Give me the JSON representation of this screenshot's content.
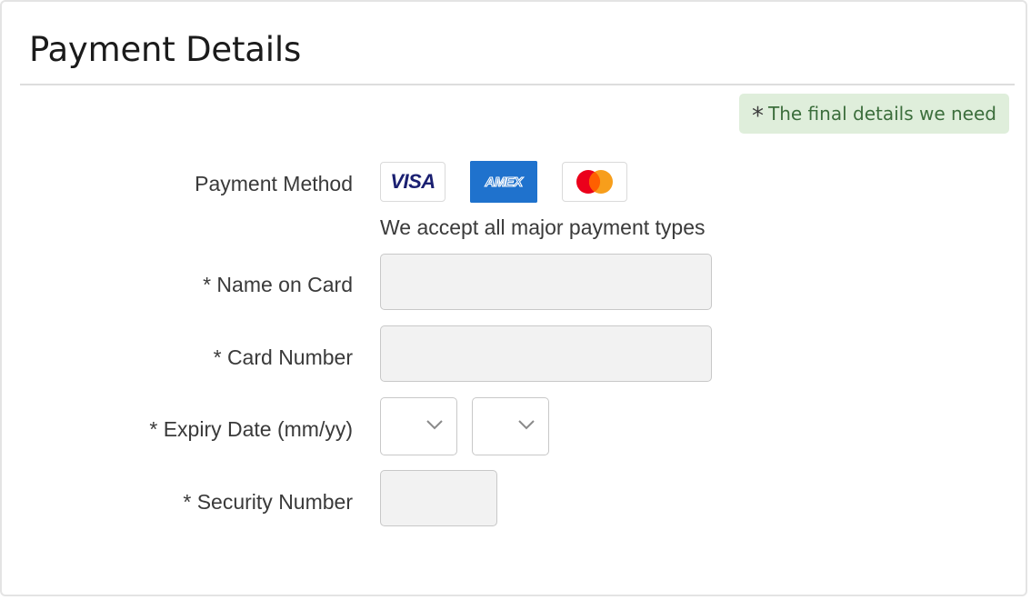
{
  "panel": {
    "title": "Payment Details",
    "required_note": {
      "star": "*",
      "text": "The final details we need",
      "bg_color": "#dfeedb"
    }
  },
  "payment_method": {
    "label": "Payment Method",
    "cards": [
      {
        "name": "visa",
        "text": "VISA"
      },
      {
        "name": "amex",
        "text": "AMEX"
      },
      {
        "name": "mastercard",
        "text": ""
      }
    ],
    "helper": "We accept all major payment types"
  },
  "fields": {
    "name_on_card": {
      "label": "* Name on Card",
      "value": "",
      "placeholder": ""
    },
    "card_number": {
      "label": "* Card Number",
      "value": "",
      "placeholder": ""
    },
    "expiry": {
      "label": "* Expiry Date (mm/yy)",
      "month_value": "",
      "year_value": ""
    },
    "security_number": {
      "label": "* Security Number",
      "value": "",
      "placeholder": ""
    }
  },
  "colors": {
    "amex_blue": "#1f72cd",
    "visa_navy": "#1a1f71",
    "mc_red": "#eb001b",
    "mc_orange": "#f79e1b",
    "input_bg": "#f2f2f2"
  }
}
